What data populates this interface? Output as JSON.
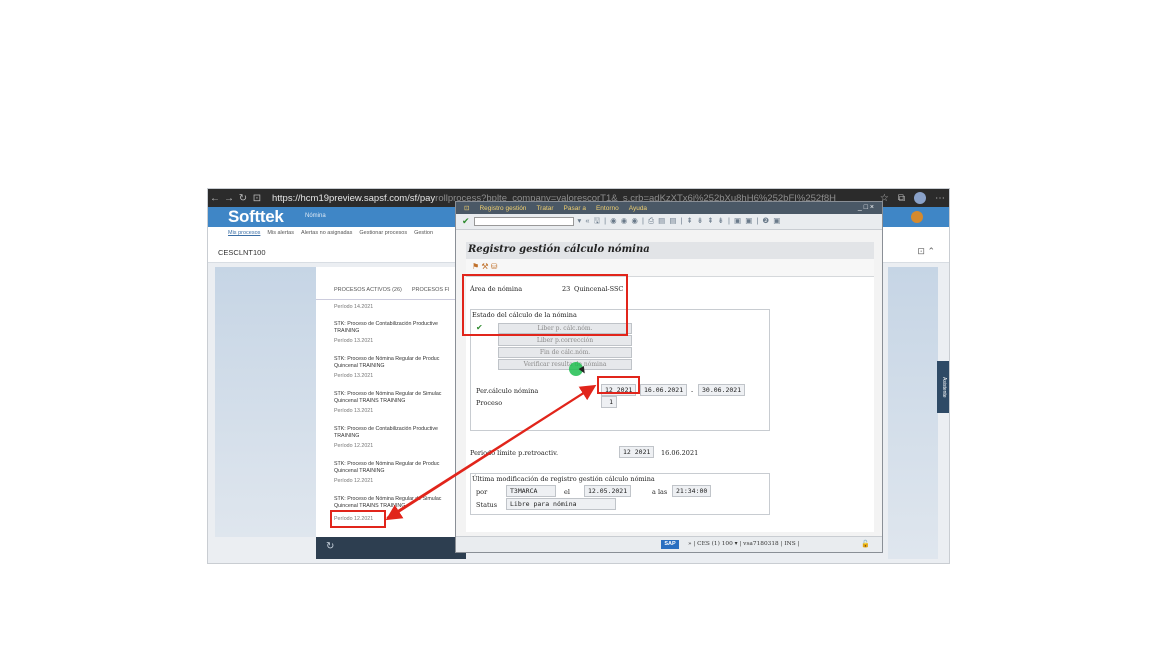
{
  "browser": {
    "url": "https://hcm19preview.sapsf.com/sf/pay",
    "url_tail": "rollprocess?bplte_company=valorescorT1&_s.crb=adKzXTx6i%252bXu8hH6%252bFI%252f8H"
  },
  "successfactors": {
    "logo": "Softtek",
    "module": "Nómina",
    "tabs": [
      "Mis procesos",
      "Mis alertas",
      "Alertas no asignadas",
      "Gestionar procesos",
      "Gestion"
    ],
    "client": "CESCLNT100",
    "process_tabs": [
      "PROCESOS ACTIVOS (26)",
      "PROCESOS FI"
    ],
    "process_list": [
      {
        "title": "",
        "period": "Período 14.2021"
      },
      {
        "title": "STK: Proceso de Contabilización Productive TRAINING",
        "period": "Período 13.2021"
      },
      {
        "title": "STK: Proceso de Nómina Regular de Produc Quincenal TRAINING",
        "period": "Período 13.2021"
      },
      {
        "title": "STK: Proceso de Nómina Regular de Simulac Quincenal TRAINS TRAINING",
        "period": "Período 13.2021"
      },
      {
        "title": "STK: Proceso de Contabilización Productive TRAINING",
        "period": "Período 12.2021"
      },
      {
        "title": "STK: Proceso de Nómina Regular de Produc Quincenal TRAINING",
        "period": "Período 12.2021"
      },
      {
        "title": "STK: Proceso de Nómina Regular de Simulac Quincenal TRAINS TRAINING",
        "period": "Período 12.2021"
      }
    ],
    "assistant": "Asistente"
  },
  "sap": {
    "menu": [
      "Registro gestión",
      "Tratar",
      "Pasar a",
      "Entorno",
      "Ayuda"
    ],
    "window_controls": "_ □ ×",
    "toolbar_icons": "▾ « 🖫 | ◉ ◉ ◉ | ⎙ ▤ ▤ | ⇞ ⇟ ⇞ ⇟ | ▣ ▣ | ❷ ▣",
    "heading": "Registro gestión cálculo nómina",
    "app_tools": "⚑ ⚒ ⛁",
    "area_label": "Área de nómina",
    "area_value": "23",
    "area_text": "Quincenal-SSC",
    "status_group_title": "Estado del cálculo de la nómina",
    "status_check": "✔",
    "btn_liberar": "Liber p. cálc.nóm.",
    "btn_correccion": "Liber p.corrección",
    "btn_fin": "Fin de cálc.nóm.",
    "btn_verificar": "Verificar resulta de nómina",
    "per_label": "Per.cálculo nómina",
    "per_value": "12 2021",
    "per_from": "16.06.2021",
    "per_sep": "-",
    "per_to": "30.06.2021",
    "proceso_label": "Proceso",
    "proceso_value": "1",
    "retro_label": "Periodo límite p.retroactiv.",
    "retro_value": "12 2021",
    "retro_date": "16.06.2021",
    "lastmod_title": "Última modificación de registro gestión cálculo nómina",
    "por_label": "por",
    "por_value": "T3MARCA",
    "el_label": "el",
    "el_value": "12.05.2021",
    "alas_label": "a las",
    "alas_value": "21:34:00",
    "status_label": "Status",
    "status_value": "Libre para nómina",
    "statusbar": "»  |  CES (1) 100 ▾  |  vsa7180318  |  INS  |",
    "sap_logo": "SAP"
  },
  "colors": {
    "sf_blue": "#3f86c6",
    "sap_title": "#4a5866",
    "highlight_red": "#e1251b",
    "cursor_green": "#1ebe50"
  }
}
